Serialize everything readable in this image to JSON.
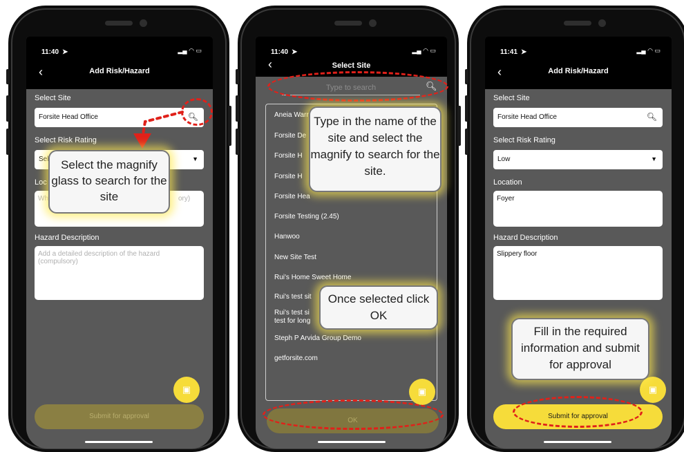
{
  "accent_colors": {
    "callout_glow": "#f6dc3a",
    "annotation_red": "#e0211a",
    "app_bg": "#595959"
  },
  "phone1": {
    "time": "11:40",
    "status_icons": "▎• ● ▮",
    "title": "Add Risk/Hazard",
    "site_label": "Select Site",
    "site_value": "Forsite Head Office",
    "rating_label": "Select Risk Rating",
    "rating_value": "Sele",
    "location_label": "Loc",
    "location_placeholder_start": "Wh",
    "location_placeholder_end": "ory)",
    "hazard_label": "Hazard Description",
    "hazard_placeholder": "Add a detailed description of the hazard (compulsory)",
    "submit": "Submit for approval",
    "callout": "Select the magnify glass to search for the site"
  },
  "phone2": {
    "time": "11:40",
    "title": "Select Site",
    "search_placeholder": "Type to search",
    "sites": [
      "Aneia Warr",
      "Forsite De",
      "Forsite H",
      "Forsite H",
      "Forsite Hea",
      "Forsite Testing (2.45)",
      "Hanwoo",
      "New Site Test",
      "Rui's Home Sweet Home",
      "Rui's test sit",
      "Rui's test si",
      "test for long",
      "Steph P Arvida Group Demo",
      "getforsite.com"
    ],
    "ok": "OK",
    "callout_search": "Type in the name of the site and select the magnify to search for the site.",
    "callout_ok": "Once selected click OK"
  },
  "phone3": {
    "time": "11:41",
    "title": "Add Risk/Hazard",
    "site_label": "Select Site",
    "site_value": "Forsite Head Office",
    "rating_label": "Select Risk Rating",
    "rating_value": "Low",
    "location_label": "Location",
    "location_value": "Foyer",
    "hazard_label": "Hazard Description",
    "hazard_value": "Slippery floor",
    "submit": "Submit for approval",
    "callout": "Fill in the required information and submit for approval"
  }
}
